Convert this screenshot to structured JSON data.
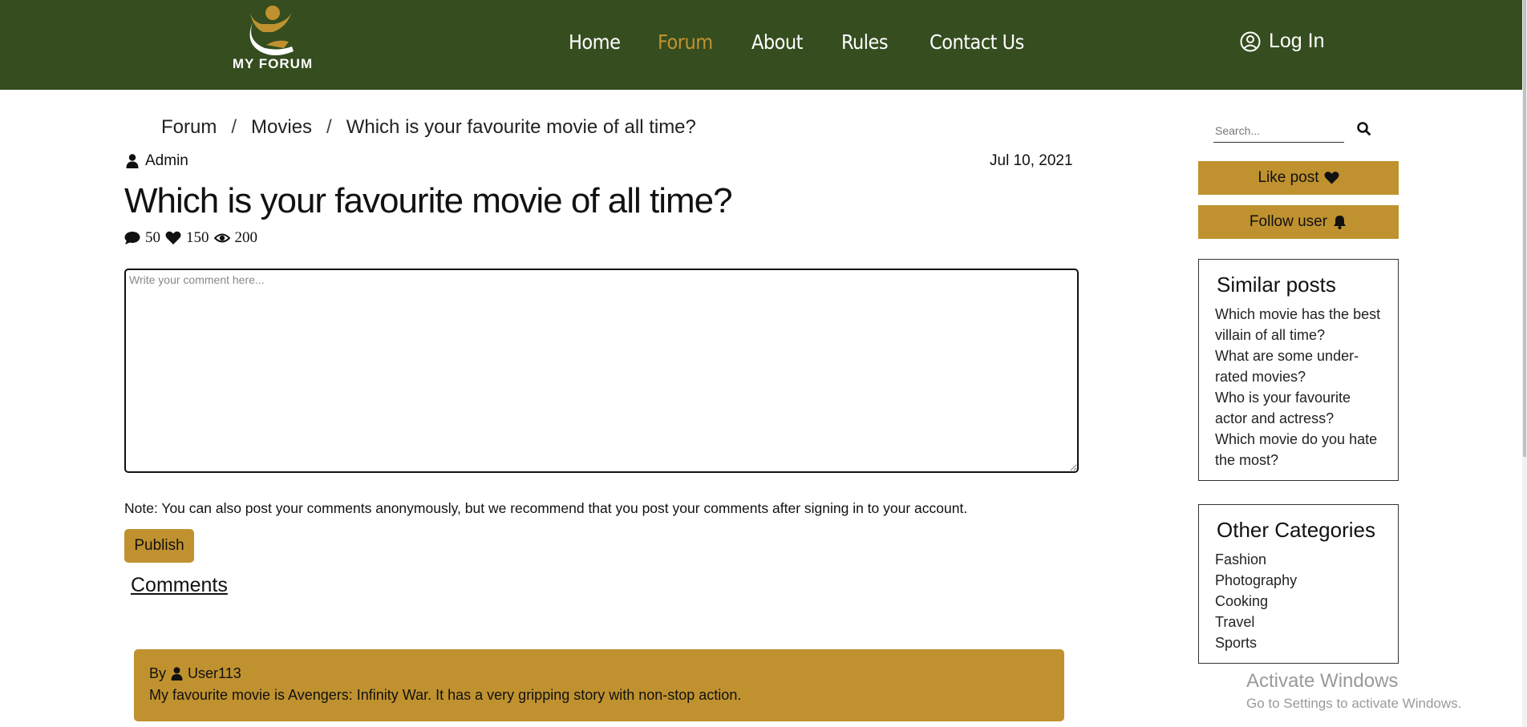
{
  "nav": {
    "logo_text": "MY FORUM",
    "links": [
      "Home",
      "Forum",
      "About",
      "Rules",
      "Contact Us"
    ],
    "active": "Forum",
    "login_label": "Log In"
  },
  "breadcrumb": [
    "Forum",
    "Movies",
    "Which is your favourite movie of all time?"
  ],
  "breadcrumb_sep": "/",
  "post": {
    "author": "Admin",
    "date": "Jul 10, 2021",
    "title": "Which is your favourite movie of all time?",
    "comments_count": "50",
    "likes_count": "150",
    "views_count": "200"
  },
  "comment_form": {
    "placeholder": "Write your comment here...",
    "value": "",
    "note": "Note: You can also post your comments anonymously, but we recommend that you post your comments after signing in to your account.",
    "publish_label": "Publish"
  },
  "comments": {
    "heading": "Comments",
    "items": [
      {
        "by_label": "By",
        "user": "User113",
        "text": "My favourite movie is Avengers: Infinity War. It has a very gripping story with non-stop action."
      }
    ]
  },
  "sidebar": {
    "search_placeholder": "Search...",
    "like_label": "Like post",
    "follow_label": "Follow user",
    "similar_posts": {
      "title": "Similar posts",
      "items": [
        "Which movie has the best villain of all time?",
        "What are some under-rated movies?",
        "Who is your favourite actor and actress?",
        "Which movie do you hate the most?"
      ]
    },
    "other_categories": {
      "title": "Other Categories",
      "items": [
        "Fashion",
        "Photography",
        "Cooking",
        "Travel",
        "Sports"
      ]
    }
  },
  "watermark": {
    "title": "Activate Windows",
    "subtitle": "Go to Settings to activate Windows."
  },
  "colors": {
    "navbar": "#354d1f",
    "accent": "#c0922f"
  }
}
